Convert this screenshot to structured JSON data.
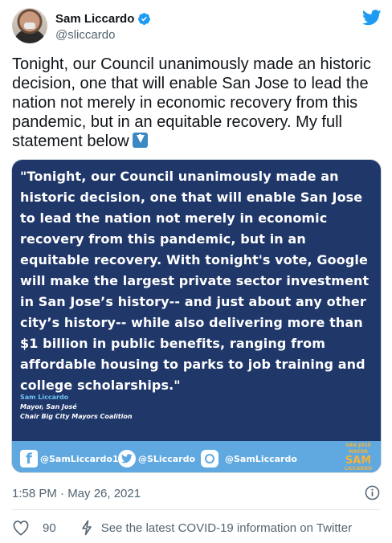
{
  "author": {
    "name": "Sam Liccardo",
    "handle": "@sliccardo"
  },
  "tweet": {
    "text": "Tonight, our Council unanimously made an historic decision, one that will enable San Jose to lead the nation not merely in economic recovery from this pandemic, but in an equitable recovery. My full statement below",
    "arrow_icon": "down-arrow-emoji"
  },
  "media": {
    "quote": "\"Tonight, our Council unanimously made an historic decision, one that will enable San Jose to lead the nation not merely in economic recovery from this pandemic, but in an equitable recovery. With tonight's vote, Google will make the largest private sector investment in San Jose’s history-- and just about any other city’s history-- while also delivering more than $1 billion in public benefits, ranging from affordable housing to parks to job training and college scholarships.\"",
    "signature": {
      "name": "Sam Liccardo",
      "title": "Mayor, San José",
      "role": "Chair Big City Mayors Coalition"
    },
    "social": {
      "facebook": "@SamLiccardo1",
      "twitter": "@SLiccardo",
      "instagram": "@SamLiccardo"
    },
    "logo": {
      "top": "SAN JOSÉ",
      "middle": "MAYOR",
      "big": "SAM",
      "bottom": "LICCARDO"
    },
    "colors": {
      "background": "#20376a",
      "band": "#5fa8e0",
      "logo": "#f2b33d"
    }
  },
  "meta": {
    "timestamp": "1:58 PM · May 26, 2021"
  },
  "actions": {
    "likes": "90",
    "covid_link": "See the latest COVID-19 information on Twitter"
  }
}
